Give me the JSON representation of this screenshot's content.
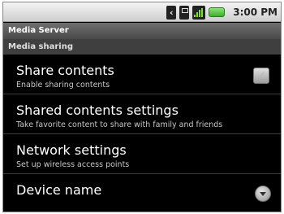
{
  "status_bar": {
    "time": "3:00 PM",
    "icons": [
      "bluetooth-icon",
      "sd-card-icon",
      "signal-icon",
      "battery-icon"
    ]
  },
  "title": "Media Server",
  "section": "Media sharing",
  "items": [
    {
      "title": "Share contents",
      "subtitle": "Enable sharing contents",
      "control": "checkbox",
      "checked": false
    },
    {
      "title": "Shared contents settings",
      "subtitle": "Take favorite content to share with family and friends"
    },
    {
      "title": "Network settings",
      "subtitle": "Set up wireless access points"
    },
    {
      "title": "Device name",
      "subtitle": "",
      "control": "dropdown"
    }
  ]
}
